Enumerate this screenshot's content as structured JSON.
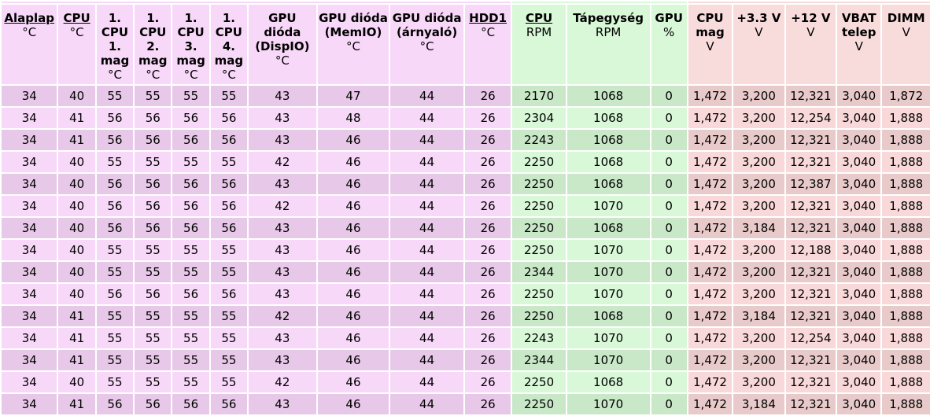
{
  "headers": [
    {
      "title": "Alaplap",
      "unit": "°C",
      "link": true
    },
    {
      "title": "CPU",
      "unit": "°C",
      "link": true
    },
    {
      "title": "1. CPU 1. mag",
      "unit": "°C",
      "link": false
    },
    {
      "title": "1. CPU 2. mag",
      "unit": "°C",
      "link": false
    },
    {
      "title": "1. CPU 3. mag",
      "unit": "°C",
      "link": false
    },
    {
      "title": "1. CPU 4. mag",
      "unit": "°C",
      "link": false
    },
    {
      "title": "GPU dióda (DispIO)",
      "unit": "°C",
      "link": false
    },
    {
      "title": "GPU dióda (MemIO)",
      "unit": "°C",
      "link": false
    },
    {
      "title": "GPU dióda (árnyaló)",
      "unit": "°C",
      "link": false
    },
    {
      "title": "HDD1",
      "unit": "°C",
      "link": true
    },
    {
      "title": "CPU",
      "unit": "RPM",
      "link": true
    },
    {
      "title": "Tápegység",
      "unit": "RPM",
      "link": false
    },
    {
      "title": "GPU",
      "unit": "%",
      "link": false
    },
    {
      "title": "CPU mag",
      "unit": "V",
      "link": false
    },
    {
      "title": "+3.3 V",
      "unit": "V",
      "link": false
    },
    {
      "title": "+12 V",
      "unit": "V",
      "link": false
    },
    {
      "title": "VBAT telep",
      "unit": "V",
      "link": false
    },
    {
      "title": "DIMM",
      "unit": "V",
      "link": false
    }
  ],
  "rows": [
    [
      "34",
      "40",
      "55",
      "55",
      "55",
      "55",
      "43",
      "47",
      "44",
      "26",
      "2170",
      "1068",
      "0",
      "1,472",
      "3,200",
      "12,321",
      "3,040",
      "1,872"
    ],
    [
      "34",
      "41",
      "56",
      "56",
      "56",
      "56",
      "43",
      "48",
      "44",
      "26",
      "2304",
      "1068",
      "0",
      "1,472",
      "3,200",
      "12,254",
      "3,040",
      "1,888"
    ],
    [
      "34",
      "41",
      "56",
      "56",
      "56",
      "56",
      "43",
      "46",
      "44",
      "26",
      "2243",
      "1068",
      "0",
      "1,472",
      "3,200",
      "12,321",
      "3,040",
      "1,888"
    ],
    [
      "34",
      "40",
      "55",
      "55",
      "55",
      "55",
      "42",
      "46",
      "44",
      "26",
      "2250",
      "1068",
      "0",
      "1,472",
      "3,200",
      "12,321",
      "3,040",
      "1,888"
    ],
    [
      "34",
      "40",
      "56",
      "56",
      "56",
      "56",
      "43",
      "46",
      "44",
      "26",
      "2250",
      "1068",
      "0",
      "1,472",
      "3,200",
      "12,387",
      "3,040",
      "1,888"
    ],
    [
      "34",
      "40",
      "56",
      "56",
      "56",
      "56",
      "42",
      "46",
      "44",
      "26",
      "2250",
      "1070",
      "0",
      "1,472",
      "3,200",
      "12,321",
      "3,040",
      "1,888"
    ],
    [
      "34",
      "40",
      "56",
      "56",
      "56",
      "56",
      "43",
      "46",
      "44",
      "26",
      "2250",
      "1068",
      "0",
      "1,472",
      "3,184",
      "12,321",
      "3,040",
      "1,888"
    ],
    [
      "34",
      "40",
      "55",
      "55",
      "55",
      "55",
      "43",
      "46",
      "44",
      "26",
      "2250",
      "1070",
      "0",
      "1,472",
      "3,200",
      "12,188",
      "3,040",
      "1,888"
    ],
    [
      "34",
      "40",
      "55",
      "55",
      "55",
      "55",
      "43",
      "46",
      "44",
      "26",
      "2344",
      "1070",
      "0",
      "1,472",
      "3,200",
      "12,321",
      "3,040",
      "1,888"
    ],
    [
      "34",
      "40",
      "56",
      "56",
      "56",
      "56",
      "43",
      "46",
      "44",
      "26",
      "2250",
      "1070",
      "0",
      "1,472",
      "3,200",
      "12,321",
      "3,040",
      "1,888"
    ],
    [
      "34",
      "41",
      "55",
      "55",
      "55",
      "55",
      "42",
      "46",
      "44",
      "26",
      "2250",
      "1068",
      "0",
      "1,472",
      "3,184",
      "12,321",
      "3,040",
      "1,888"
    ],
    [
      "34",
      "41",
      "55",
      "55",
      "55",
      "55",
      "43",
      "46",
      "44",
      "26",
      "2243",
      "1070",
      "0",
      "1,472",
      "3,200",
      "12,254",
      "3,040",
      "1,888"
    ],
    [
      "34",
      "41",
      "55",
      "55",
      "55",
      "55",
      "43",
      "46",
      "44",
      "26",
      "2344",
      "1070",
      "0",
      "1,472",
      "3,200",
      "12,321",
      "3,040",
      "1,888"
    ],
    [
      "34",
      "40",
      "55",
      "55",
      "55",
      "55",
      "42",
      "46",
      "44",
      "26",
      "2250",
      "1068",
      "0",
      "1,472",
      "3,200",
      "12,321",
      "3,040",
      "1,888"
    ],
    [
      "34",
      "41",
      "56",
      "56",
      "56",
      "56",
      "43",
      "46",
      "44",
      "26",
      "2250",
      "1070",
      "0",
      "1,472",
      "3,184",
      "12,321",
      "3,040",
      "1,888"
    ]
  ],
  "colors": {
    "group_temperature": "#f8d8f8",
    "group_fan": "#d8f8d8",
    "group_voltage": "#f8dcdc"
  }
}
